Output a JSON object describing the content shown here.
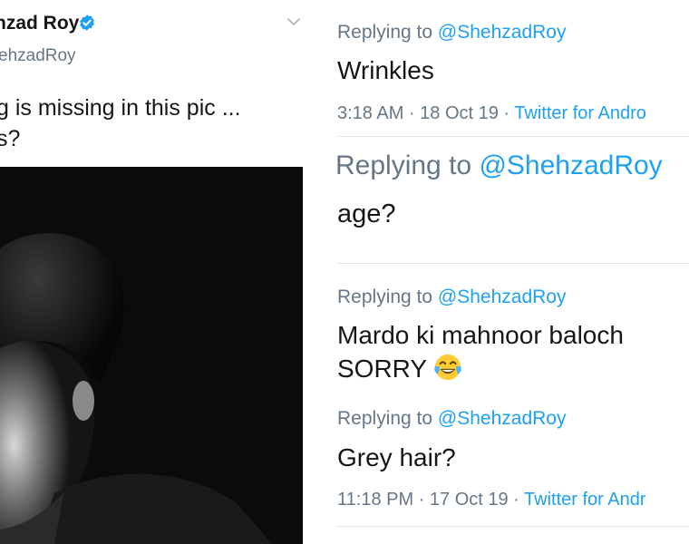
{
  "original_tweet": {
    "author_name": "hzad Roy",
    "author_handle": "ehzadRoy",
    "text_line1": "g is missing in this pic ...",
    "text_line2": "s?"
  },
  "replies": [
    {
      "replying_prefix": "Replying to ",
      "mention": "@ShehzadRoy",
      "text": "Wrinkles",
      "timestamp": "3:18 AM · 18 Oct 19 · ",
      "client": "Twitter for Andro"
    },
    {
      "replying_prefix": "Replying to ",
      "mention": "@ShehzadRoy",
      "text": "age?"
    },
    {
      "replying_prefix": "Replying to ",
      "mention": "@ShehzadRoy",
      "text_line1": "Mardo ki mahnoor baloch",
      "text_line2": "SORRY",
      "emoji": "face-with-tears-of-joy"
    },
    {
      "replying_prefix": "Replying to ",
      "mention": "@ShehzadRoy",
      "text": "Grey hair?",
      "timestamp": "11:18 PM · 17 Oct 19 · ",
      "client": "Twitter for Andr"
    }
  ],
  "colors": {
    "text": "#14171a",
    "secondary": "#657786",
    "accent": "#1da1f2",
    "rule": "#e1e8ed"
  }
}
